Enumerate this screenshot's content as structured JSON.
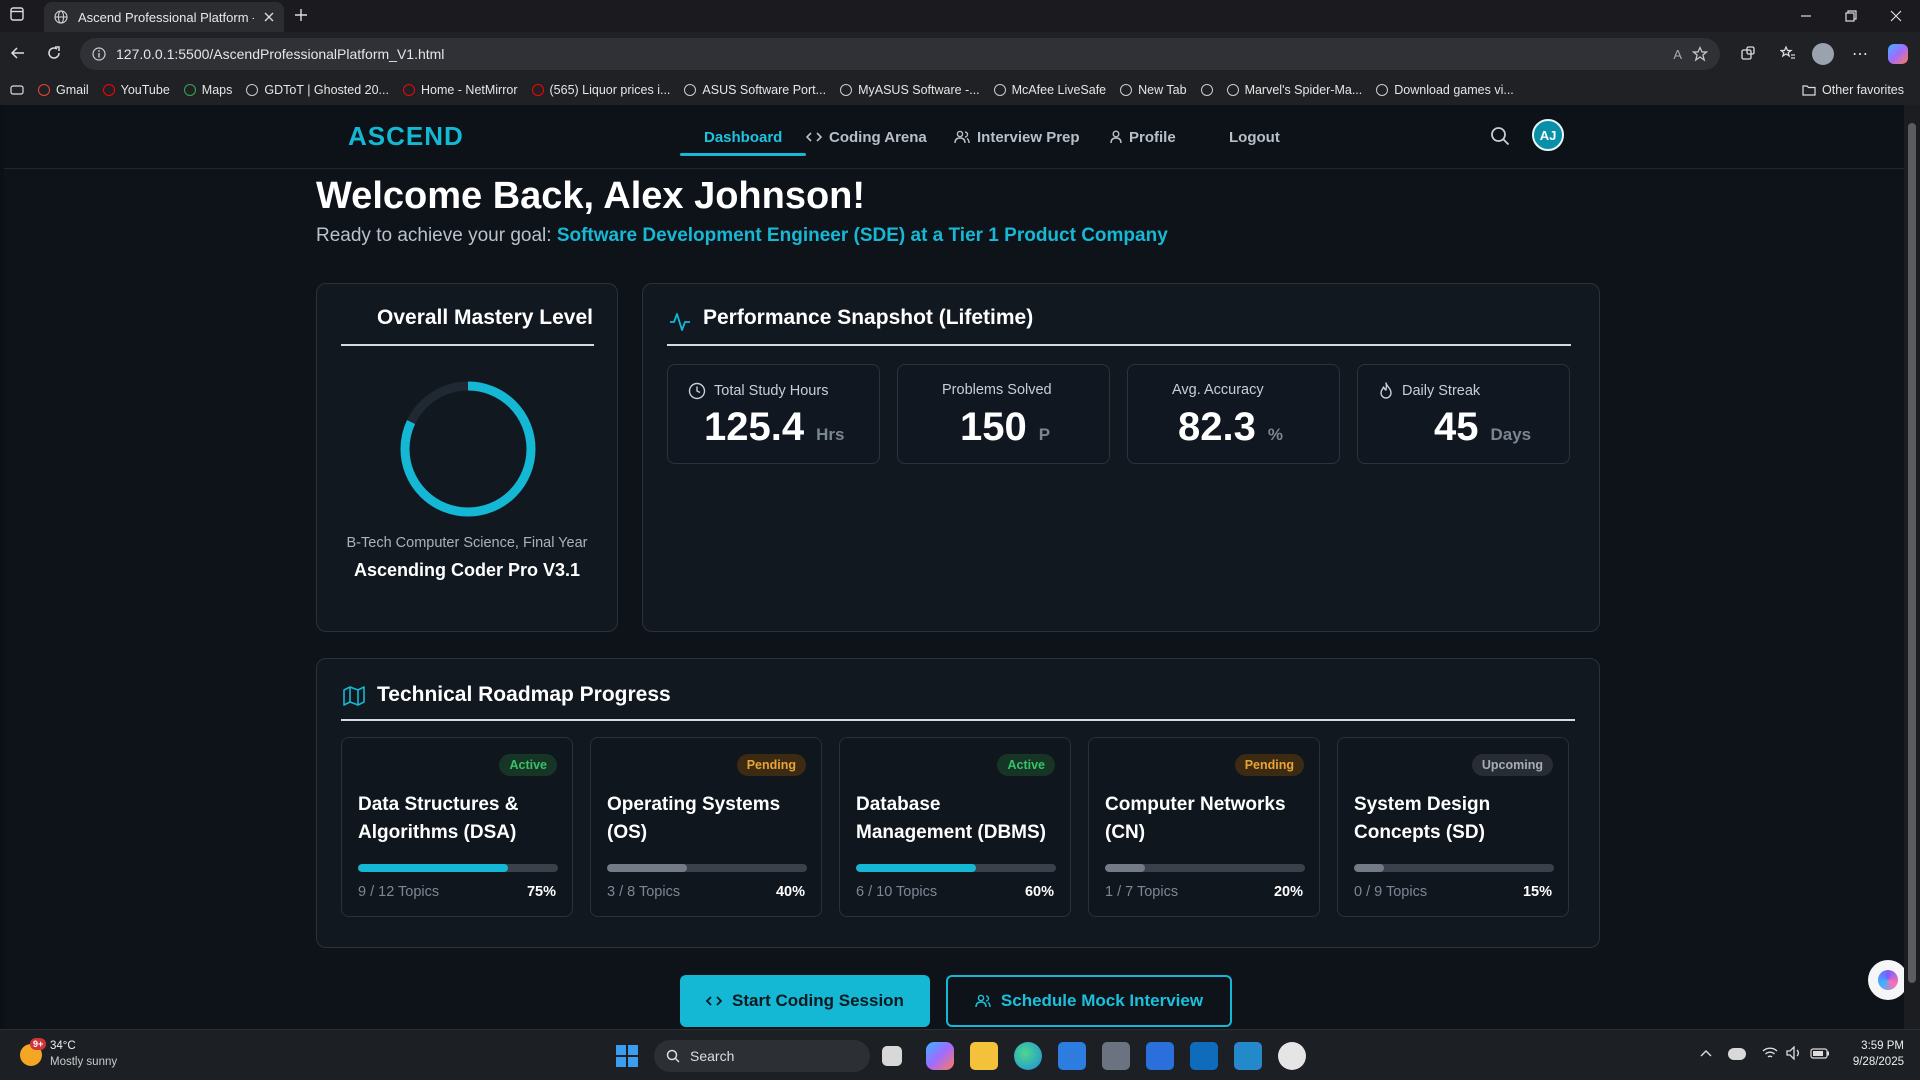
{
  "browser": {
    "tab_title": "Ascend Professional Platform - Co",
    "url": "127.0.0.1:5500/AscendProfessionalPlatform_V1.html",
    "bookmarks": [
      "Gmail",
      "YouTube",
      "Maps",
      "GDToT | Ghosted 20...",
      "Home - NetMirror",
      "(565) Liquor prices i...",
      "ASUS Software Port...",
      "MyASUS Software -...",
      "McAfee LiveSafe",
      "New Tab",
      "",
      "Marvel's Spider-Ma...",
      "Download games vi..."
    ],
    "other_favorites": "Other favorites"
  },
  "app": {
    "logo": "ASCEND",
    "nav": [
      {
        "label": "Dashboard",
        "active": true
      },
      {
        "label": "Coding Arena"
      },
      {
        "label": "Interview Prep"
      },
      {
        "label": "Profile"
      },
      {
        "label": "Logout"
      }
    ],
    "avatar_initials": "AJ",
    "accent": "#14b8d4"
  },
  "welcome": {
    "title": "Welcome Back, Alex Johnson!",
    "goal_prefix": "Ready to achieve your goal:",
    "goal": "Software Development Engineer (SDE) at a Tier 1 Product Company"
  },
  "mastery": {
    "title": "Overall Mastery Level",
    "progress_fraction": 0.82,
    "subtitle": "B-Tech Computer Science, Final Year",
    "level": "Ascending Coder Pro V3.1"
  },
  "performance": {
    "title": "Performance Snapshot (Lifetime)",
    "stats": [
      {
        "label": "Total Study Hours",
        "value": "125.4",
        "unit": "Hrs",
        "icon": "clock-icon"
      },
      {
        "label": "Problems Solved",
        "value": "150",
        "unit": "P",
        "icon": ""
      },
      {
        "label": "Avg. Accuracy",
        "value": "82.3",
        "unit": "%",
        "icon": ""
      },
      {
        "label": "Daily Streak",
        "value": "45",
        "unit": "Days",
        "icon": "flame-icon"
      }
    ]
  },
  "roadmap": {
    "title": "Technical Roadmap Progress",
    "items": [
      {
        "name": "Data Structures & Algorithms (DSA)",
        "status": "Active",
        "topics": "9 / 12 Topics",
        "pct": "75%",
        "progress": 75,
        "color": "#14b8d4"
      },
      {
        "name": "Operating Systems (OS)",
        "status": "Pending",
        "topics": "3 / 8 Topics",
        "pct": "40%",
        "progress": 40,
        "color": "#737b86"
      },
      {
        "name": "Database Management (DBMS)",
        "status": "Active",
        "topics": "6 / 10 Topics",
        "pct": "60%",
        "progress": 60,
        "color": "#14b8d4"
      },
      {
        "name": "Computer Networks (CN)",
        "status": "Pending",
        "topics": "1 / 7 Topics",
        "pct": "20%",
        "progress": 20,
        "color": "#737b86"
      },
      {
        "name": "System Design Concepts (SD)",
        "status": "Upcoming",
        "topics": "0 / 9 Topics",
        "pct": "15%",
        "progress": 15,
        "color": "#737b86"
      }
    ]
  },
  "actions": {
    "start": "Start Coding Session",
    "schedule": "Schedule Mock Interview"
  },
  "taskbar": {
    "weather_temp": "34°C",
    "weather_desc": "Mostly sunny",
    "weather_badge": "9+",
    "search": "Search",
    "time": "3:59 PM",
    "date": "9/28/2025"
  }
}
